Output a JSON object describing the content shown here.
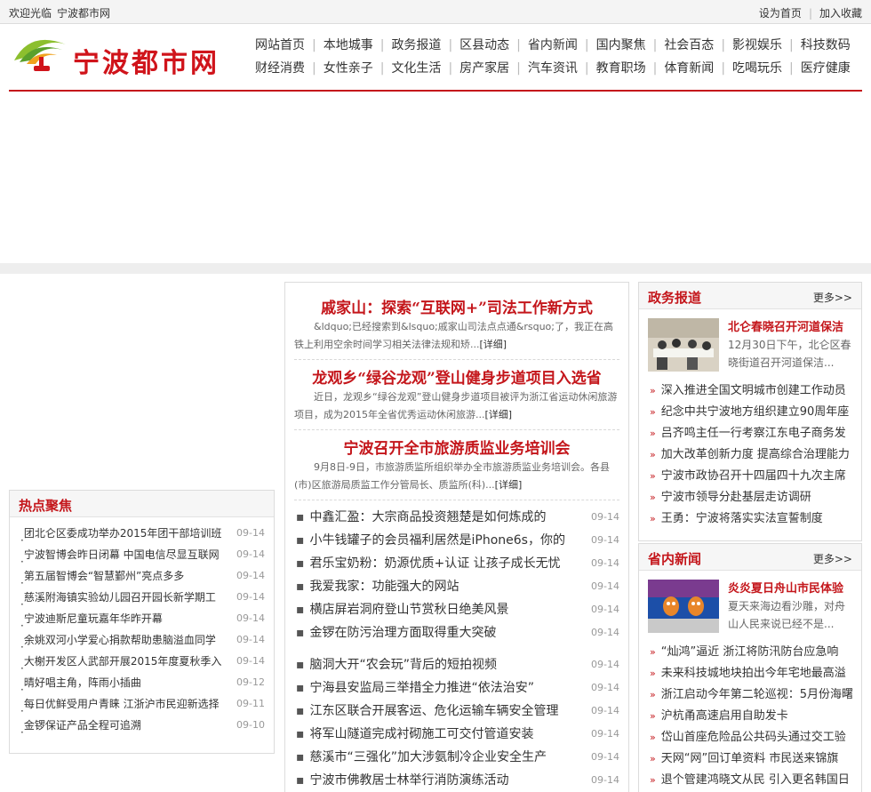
{
  "topbar": {
    "welcome": "欢迎光临",
    "site": "宁波都市网",
    "set_home": "设为首页",
    "add_fav": "加入收藏"
  },
  "logo": {
    "text": "宁波都市网"
  },
  "nav": {
    "row1": [
      "网站首页",
      "本地城事",
      "政务报道",
      "区县动态",
      "省内新闻",
      "国内聚焦",
      "社会百态",
      "影视娱乐",
      "科技数码"
    ],
    "row2": [
      "财经消费",
      "女性亲子",
      "文化生活",
      "房产家居",
      "汽车资讯",
      "教育职场",
      "体育新闻",
      "吃喝玩乐",
      "医疗健康"
    ]
  },
  "hot": {
    "title": "热点聚焦",
    "items": [
      {
        "t": "团北仑区委成功举办2015年团干部培训班",
        "d": "09-14"
      },
      {
        "t": "宁波智博会昨日闭幕 中国电信尽显互联网",
        "d": "09-14"
      },
      {
        "t": "第五届智博会“智慧鄞州”亮点多多",
        "d": "09-14"
      },
      {
        "t": "慈溪附海镇实验幼儿园召开园长新学期工",
        "d": "09-14"
      },
      {
        "t": "宁波迪斯尼童玩嘉年华昨开幕",
        "d": "09-14"
      },
      {
        "t": "余姚双河小学爱心捐款帮助患脑溢血同学",
        "d": "09-14"
      },
      {
        "t": "大榭开发区人武部开展2015年度夏秋季入",
        "d": "09-14"
      },
      {
        "t": "晴好唱主角，阵雨小插曲",
        "d": "09-12"
      },
      {
        "t": "每日优鲜受用户青睐 江浙沪市民迎新选择",
        "d": "09-11"
      },
      {
        "t": "金锣保证产品全程可追溯",
        "d": "09-10"
      }
    ]
  },
  "center": {
    "stories": [
      {
        "title": "戚家山：探索“互联网+”司法工作新方式",
        "summary": "&ldquo;已经搜索到&lsquo;戚家山司法点点通&rsquo;了，我正在高铁上利用空余时间学习相关法律法规和矫...",
        "detail": "[详细]"
      },
      {
        "title": "龙观乡“绿谷龙观”登山健身步道项目入选省",
        "summary": "近日，龙观乡“绿谷龙观”登山健身步道项目被评为浙江省运动休闲旅游项目，成为2015年全省优秀运动休闲旅游...",
        "detail": "[详细]"
      },
      {
        "title": "宁波召开全市旅游质监业务培训会",
        "summary": "9月8日-9日，市旅游质监所组织举办全市旅游质监业务培训会。各县(市)区旅游局质监工作分管局长、质监所(科)...",
        "detail": "[详细]"
      }
    ],
    "list1": [
      {
        "t": "中鑫汇盈：大宗商品投资翘楚是如何炼成的",
        "d": "09-14"
      },
      {
        "t": "小牛钱罐子的会员福利居然是iPhone6s，你的",
        "d": "09-14"
      },
      {
        "t": "君乐宝奶粉：奶源优质+认证 让孩子成长无忧",
        "d": "09-14"
      },
      {
        "t": "我爱我家：功能强大的网站",
        "d": "09-14"
      },
      {
        "t": "横店屏岩洞府登山节赏秋日绝美风景",
        "d": "09-14"
      },
      {
        "t": "金锣在防污治理方面取得重大突破",
        "d": "09-14"
      }
    ],
    "list2": [
      {
        "t": "脑洞大开“农会玩”背后的短拍视频",
        "d": "09-14"
      },
      {
        "t": "宁海县安监局三举措全力推进“依法治安”",
        "d": "09-14"
      },
      {
        "t": "江东区联合开展客运、危化运输车辆安全管理",
        "d": "09-14"
      },
      {
        "t": "将军山隧道完成衬砌施工可交付管道安装",
        "d": "09-14"
      },
      {
        "t": "慈溪市“三强化”加大涉氨制冷企业安全生产",
        "d": "09-14"
      },
      {
        "t": "宁波市佛教居士林举行消防演练活动",
        "d": "09-14"
      }
    ]
  },
  "gov": {
    "title": "政务报道",
    "more": "更多>>",
    "feature_title": "北仑春晓召开河道保洁",
    "feature_desc": "12月30日下午，北仑区春晓街道召开河道保洁...",
    "items": [
      "深入推进全国文明城市创建工作动员",
      "纪念中共宁波地方组织建立90周年座",
      "吕齐鸣主任一行考察江东电子商务发",
      "加大改革创新力度 提高综合治理能力",
      "宁波市政协召开十四届四十九次主席",
      "宁波市领导分赴基层走访调研",
      "王勇：宁波将落实实法宣誓制度"
    ]
  },
  "prov": {
    "title": "省内新闻",
    "more": "更多>>",
    "feature_title": "炎炎夏日舟山市民体验",
    "feature_desc": "夏天来海边看沙雕，对舟山人民来说已经不是...",
    "items": [
      "“灿鸿”逼近 浙江将防汛防台应急响",
      "未来科技城地块拍出今年宅地最高溢",
      "浙江启动今年第二轮巡视：5月份海曙",
      "沪杭甬高速启用自助发卡",
      "岱山首座危险品公共码头通过交工验",
      "天网“网”回订单资料 市民送来锦旗",
      "退个管建鸿晓文从民 引入更名韩国日"
    ]
  }
}
